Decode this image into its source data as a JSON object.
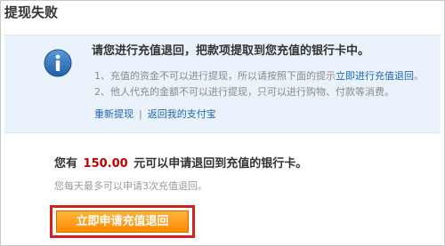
{
  "page": {
    "title": "提现失败"
  },
  "info": {
    "icon": "info-icon",
    "heading": "请您进行充值退回，把款项提取到您充值的银行卡中。",
    "line1_prefix": "1、充值的资金不可以进行提现，所以请按照下面的提示",
    "line1_link": "立即进行充值退回",
    "line1_suffix": "。",
    "line2": "2、他人代充的金额不可以进行提现，只可以进行购物、付款等消费。",
    "link_retry": "重新提现",
    "link_separator": "|",
    "link_back": "返回我的支付宝"
  },
  "summary": {
    "prefix": "您有",
    "amount": "150.00",
    "suffix": "元可以申请退回到充值的银行卡。",
    "note": "您每天最多可以申请3次充值退回。"
  },
  "action": {
    "button_label": "立即申请充值退回"
  },
  "colors": {
    "accent_link": "#1a66b3",
    "amount_red": "#c00000",
    "button_orange": "#ff9a1a",
    "highlight_red": "#d42020",
    "panel_bg": "#eaf3fb"
  }
}
